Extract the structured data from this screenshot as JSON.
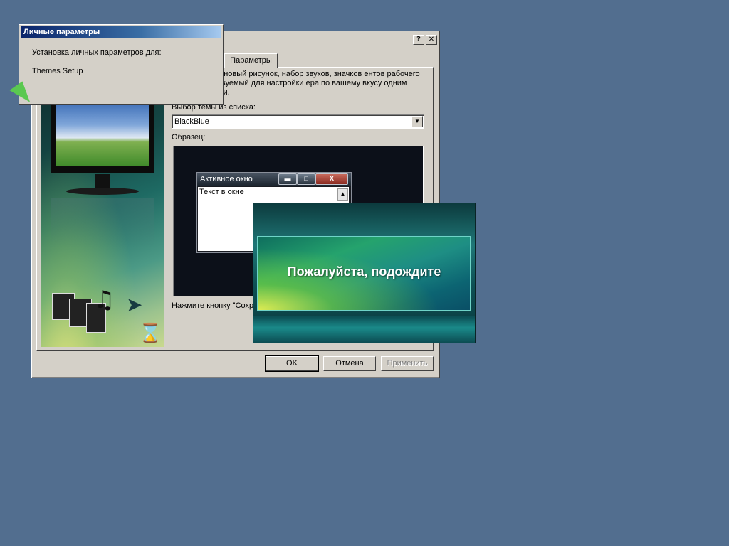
{
  "dialog": {
    "help_button": "?",
    "close_button": "✕",
    "tab_label": "Параметры",
    "description": "стола - это фоновый рисунок, набор звуков, значков ентов рабочего стола, используемый для настройки ера по вашему вкусу одним щелчком мыши.",
    "theme_select_label": "Выбор темы из списка:",
    "theme_value": "BlackBlue",
    "sample_label": "Образец:",
    "hint_text": "Нажмите кнопку \"Сохр темы или \"Удалить\" д",
    "buttons": {
      "ok": "OK",
      "cancel": "Отмена",
      "apply": "Применить"
    }
  },
  "preview": {
    "window_title": "Активное окно",
    "window_text": "Текст в окне",
    "minimize": "▬",
    "maximize": "□",
    "close": "X"
  },
  "tip": {
    "title": "Личные параметры",
    "line1": "Установка личных параметров для:",
    "line2": "Themes Setup"
  },
  "splash": {
    "message": "Пожалуйста, подождите"
  }
}
